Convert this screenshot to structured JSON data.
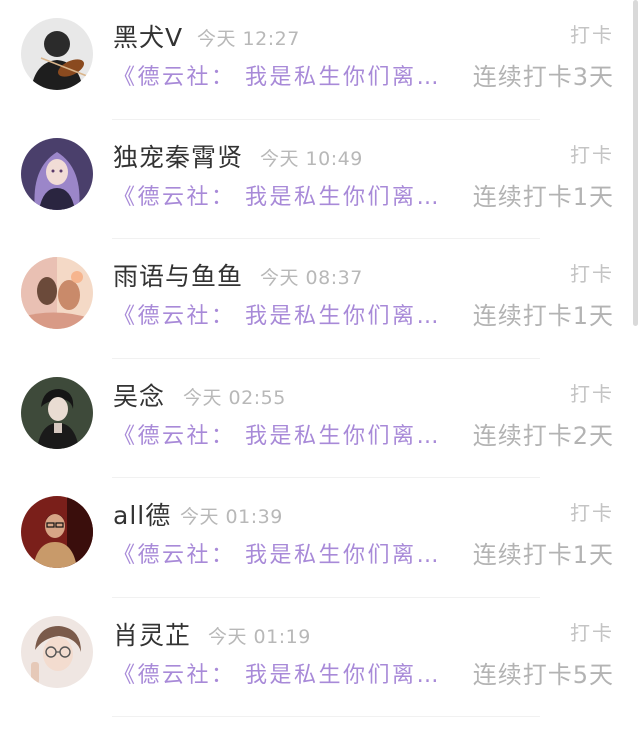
{
  "items": [
    {
      "name": "黑犬V",
      "time": "今天 12:27",
      "tag": "打卡",
      "content": "《德云社： 我是私生你们离…",
      "streak": "连续打卡3天"
    },
    {
      "name": "独宠秦霄贤",
      "time": "今天 10:49",
      "tag": "打卡",
      "content": "《德云社： 我是私生你们离…",
      "streak": "连续打卡1天"
    },
    {
      "name": "雨语与鱼鱼",
      "time": "今天 08:37",
      "tag": "打卡",
      "content": "《德云社： 我是私生你们离…",
      "streak": "连续打卡1天"
    },
    {
      "name": "吴念",
      "time": "今天 02:55",
      "tag": "打卡",
      "content": "《德云社： 我是私生你们离…",
      "streak": "连续打卡2天"
    },
    {
      "name": "all德",
      "time": "今天 01:39",
      "tag": "打卡",
      "content": "《德云社： 我是私生你们离…",
      "streak": "连续打卡1天"
    },
    {
      "name": "肖灵芷",
      "time": "今天 01:19",
      "tag": "打卡",
      "content": "《德云社： 我是私生你们离…",
      "streak": "连续打卡5天"
    }
  ],
  "colors": {
    "content_accent": "#a88ad8",
    "name": "#333333",
    "muted": "#b8b8b8"
  }
}
